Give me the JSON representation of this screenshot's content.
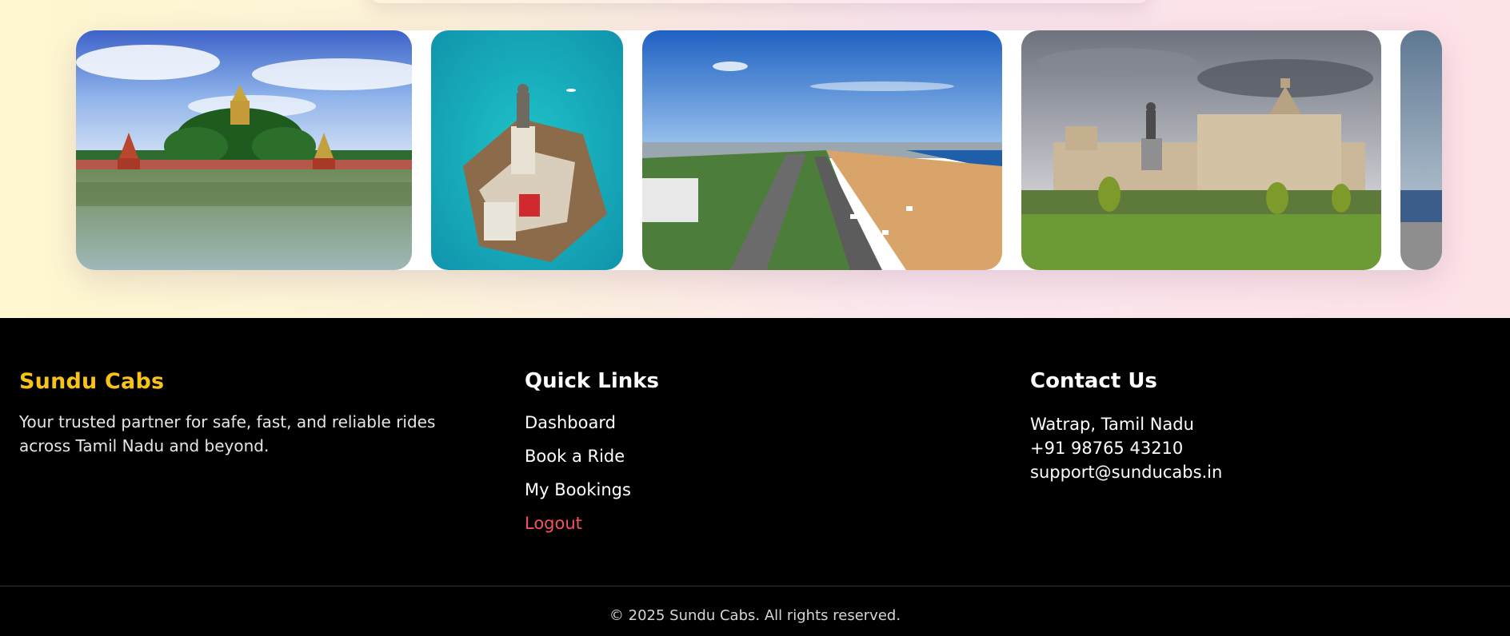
{
  "colors": {
    "brand": "#f7c31a",
    "logout": "#f2545b",
    "footer_bg": "#000000"
  },
  "gallery": {
    "images": [
      {
        "name": "temple-tank-photo"
      },
      {
        "name": "rock-memorial-photo"
      },
      {
        "name": "marina-beach-photo"
      },
      {
        "name": "vidhana-soudha-photo"
      },
      {
        "name": "partial-photo"
      }
    ]
  },
  "footer": {
    "brand": {
      "title": "Sundu Cabs",
      "description": "Your trusted partner for safe, fast, and reliable rides across Tamil Nadu and beyond."
    },
    "quick_links": {
      "title": "Quick Links",
      "items": [
        "Dashboard",
        "Book a Ride",
        "My Bookings",
        "Logout"
      ]
    },
    "contact": {
      "title": "Contact Us",
      "address": "Watrap, Tamil Nadu",
      "phone": "+91 98765 43210",
      "email": "support@sunducabs.in"
    },
    "copyright": "© 2025 Sundu Cabs. All rights reserved."
  }
}
